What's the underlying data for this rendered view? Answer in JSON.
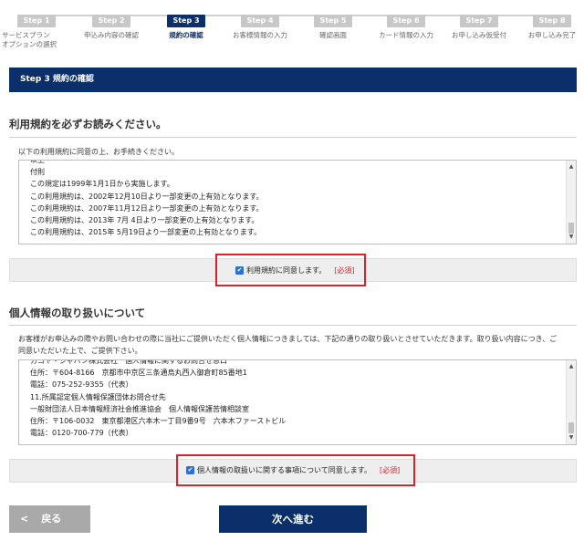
{
  "steps": [
    {
      "badge": "Step 1",
      "label_lines": [
        "サービスプラン",
        "オプションの選択"
      ]
    },
    {
      "badge": "Step 2",
      "label_lines": [
        "申込み内容の確認"
      ]
    },
    {
      "badge": "Step 3",
      "label_lines": [
        "規約の確認"
      ],
      "active": true
    },
    {
      "badge": "Step 4",
      "label_lines": [
        "お客様情報の入力"
      ]
    },
    {
      "badge": "Step 5",
      "label_lines": [
        "確認画面"
      ]
    },
    {
      "badge": "Step 6",
      "label_lines": [
        "カード情報の入力"
      ]
    },
    {
      "badge": "Step 7",
      "label_lines": [
        "お申し込み仮受付"
      ]
    },
    {
      "badge": "Step 8",
      "label_lines": [
        "お申し込み完了"
      ]
    }
  ],
  "band_title": "Step 3 規約の確認",
  "terms": {
    "heading": "利用規約を必ずお読みください。",
    "intro": "以下の利用規約に同意の上、お手続きください。",
    "lines": [
      "以上",
      "付則",
      "この規定は1999年1月1日から実施します。",
      "この利用規約は、2002年12月10日より一部変更の上有効となります。",
      "この利用規約は、2007年11月12日より一部変更の上有効となります。",
      "この利用規約は、2013年 7月 4日より一部変更の上有効となります。",
      "この利用規約は、2015年 5月19日より一部変更の上有効となります。"
    ],
    "agree_label": "利用規約に同意します。",
    "required": "[必須]"
  },
  "privacy": {
    "heading": "個人情報の取り扱いについて",
    "intro_lines": [
      "お客様がお申込みの際やお問い合わせの際に当社にご提供いただく個人情報につきましては、下記の通りの取り扱いとさせていただきます。取り扱い内容につき、ご",
      "同意いただいた上で、ご提供下さい。"
    ],
    "lines": [
      "カゴヤ・ジャパン株式会社　個人情報に関するお問合せ窓口",
      "住所：〒604-8166　京都市中京区三条通烏丸西入御倉町85番地1",
      "電話：075-252-9355（代表）",
      "11.所属認定個人情報保護団体お問合せ先",
      "一般財団法人日本情報経済社会推進協会　個人情報保護苦情相談室",
      "住所：〒106-0032　東京都港区六本木一丁目9番9号　六本木ファーストビル",
      "電話：0120-700-779（代表）"
    ],
    "agree_label": "個人情報の取扱いに関する事項について同意します。",
    "required": "[必須]"
  },
  "buttons": {
    "back": "戻る",
    "back_chevron": "<",
    "next": "次へ進む"
  },
  "colors": {
    "navy": "#0b2f6b",
    "required_red": "#d9232b",
    "checkbox_blue": "#2a6fd6",
    "inactive_step": "#c8c8c8"
  }
}
